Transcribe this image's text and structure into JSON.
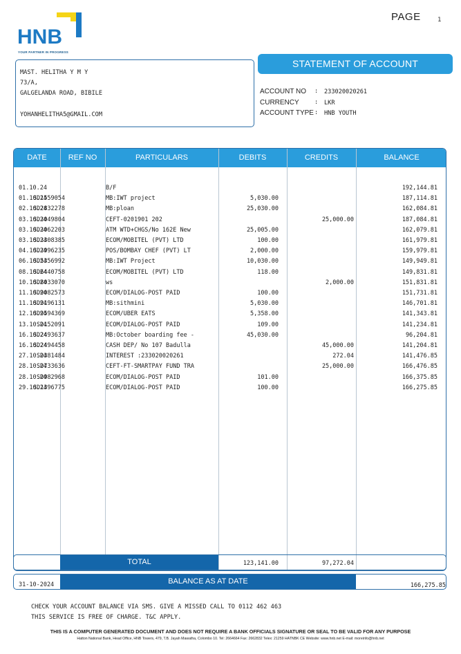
{
  "page": {
    "label": "PAGE",
    "number": "1"
  },
  "logo": {
    "text": "HNB",
    "tagline": "YOUR PARTNER IN PROGRESS"
  },
  "customer": {
    "name": "MAST. HELITHA Y M Y",
    "address1": "73/A,",
    "address2": "GALGELANDA ROAD, BIBILE",
    "email": "YOHANHELITHA5@GMAIL.COM"
  },
  "statement_title": "STATEMENT OF ACCOUNT",
  "account": {
    "number_label": "ACCOUNT NO",
    "number": "233020020261",
    "currency_label": "CURRENCY",
    "currency": "LKR",
    "type_label": "ACCOUNT TYPE",
    "type": "HNB YOUTH",
    "colon": ":"
  },
  "table": {
    "headers": {
      "date": "DATE",
      "ref": "REF NO",
      "particulars": "PARTICULARS",
      "debits": "DEBITS",
      "credits": "CREDITS",
      "balance": "BALANCE"
    },
    "rows": [
      {
        "date": "01.10.24",
        "ref": "",
        "particulars": "B/F",
        "debit": "",
        "credit": "",
        "balance": "192,144.81"
      },
      {
        "date": "01.10.24",
        "ref": "SD1559054",
        "particulars": "MB:IWT project",
        "debit": "5,030.00",
        "credit": "",
        "balance": "187,114.81"
      },
      {
        "date": "02.10.24",
        "ref": "SD2832278",
        "particulars": "MB:ploan",
        "debit": "25,030.00",
        "credit": "",
        "balance": "162,084.81"
      },
      {
        "date": "03.10.24",
        "ref": "SD3049804",
        "particulars": "CEFT-0201901          202",
        "debit": "",
        "credit": "25,000.00",
        "balance": "187,084.81"
      },
      {
        "date": "03.10.24",
        "ref": "SD3062203",
        "particulars": "ATM WTD+CHGS/No 162E New",
        "debit": "25,005.00",
        "credit": "",
        "balance": "162,079.81"
      },
      {
        "date": "03.10.24",
        "ref": "SD3308385",
        "particulars": "ECOM/MOBITEL (PVT) LTD",
        "debit": "100.00",
        "credit": "",
        "balance": "161,979.81"
      },
      {
        "date": "04.10.24",
        "ref": "SD3996235",
        "particulars": "POS/BOMBAY CHEF (PVT) LT",
        "debit": "2,000.00",
        "credit": "",
        "balance": "159,979.81"
      },
      {
        "date": "06.10.24",
        "ref": "SD5356992",
        "particulars": "MB:IWT Project",
        "debit": "10,030.00",
        "credit": "",
        "balance": "149,949.81"
      },
      {
        "date": "08.10.24",
        "ref": "SD6440758",
        "particulars": "ECOM/MOBITEL (PVT) LTD",
        "debit": "118.00",
        "credit": "",
        "balance": "149,831.81"
      },
      {
        "date": "10.10.24",
        "ref": "SD8033070",
        "particulars": "ws",
        "debit": "",
        "credit": "2,000.00",
        "balance": "151,831.81"
      },
      {
        "date": "11.10.24",
        "ref": "SD9082573",
        "particulars": "ECOM/DIALOG-POST PAID",
        "debit": "100.00",
        "credit": "",
        "balance": "151,731.81"
      },
      {
        "date": "11.10.24",
        "ref": "SD9196131",
        "particulars": "MB:sithmini",
        "debit": "5,030.00",
        "credit": "",
        "balance": "146,701.81"
      },
      {
        "date": "12.10.24",
        "ref": "SD9594369",
        "particulars": "ECOM/UBER EATS",
        "debit": "5,358.00",
        "credit": "",
        "balance": "141,343.81"
      },
      {
        "date": "13.10.24",
        "ref": "SD152091",
        "particulars": "ECOM/DIALOG-POST PAID",
        "debit": "109.00",
        "credit": "",
        "balance": "141,234.81"
      },
      {
        "date": "16.10.24",
        "ref": "SD2493637",
        "particulars": "MB:October boarding fee -",
        "debit": "45,030.00",
        "credit": "",
        "balance": "96,204.81"
      },
      {
        "date": "16.10.24",
        "ref": "SD2494458",
        "particulars": "CASH DEP/ No 107 Badulla",
        "debit": "",
        "credit": "45,000.00",
        "balance": "141,204.81"
      },
      {
        "date": "27.10.24",
        "ref": "SD381484",
        "particulars": "INTEREST :233020020261",
        "debit": "",
        "credit": "272.04",
        "balance": "141,476.85"
      },
      {
        "date": "28.10.24",
        "ref": "SD733636",
        "particulars": "CEFT-FT-SMARTPAY FUND TRA",
        "debit": "",
        "credit": "25,000.00",
        "balance": "166,476.85"
      },
      {
        "date": "28.10.24",
        "ref": "SD982968",
        "particulars": "ECOM/DIALOG-POST PAID",
        "debit": "101.00",
        "credit": "",
        "balance": "166,375.85"
      },
      {
        "date": "29.10.24",
        "ref": "SD1396775",
        "particulars": "ECOM/DIALOG-POST PAID",
        "debit": "100.00",
        "credit": "",
        "balance": "166,275.85"
      }
    ]
  },
  "totals": {
    "label": "TOTAL",
    "debits": "123,141.00",
    "credits": "97,272.04"
  },
  "balance_at_date": {
    "date": "31-10-2024",
    "label": "BALANCE AS AT DATE",
    "value": "166,275.85"
  },
  "notice": {
    "line1": "CHECK YOUR ACCOUNT BALANCE VIA SMS. GIVE A MISSED CALL TO 0112 462 463",
    "line2": "THIS SERVICE IS FREE OF CHARGE. T&C APPLY."
  },
  "footer": {
    "disclaimer": "THIS IS A COMPUTER GENERATED DOCUMENT AND DOES NOT REQUIRE A BANK OFFICIALS SIGNATURE OR SEAL TO BE VALID FOR ANY PURPOSE",
    "address": "Hatton National Bank, Head Office, HNB Towers, 479, T.B. Jayah Mawatha, Colombo 10.  Tel: 2664664  Fax: 2662832  Telex: 21259  HATNBK CE  Website: www.hnb.net  E-mail: moreinfo@hnb.net"
  },
  "colors": {
    "brand_blue": "#2a9ddc",
    "dark_blue": "#1466aa",
    "border_blue": "#2d6fa8",
    "logo_yellow": "#f5d417"
  }
}
